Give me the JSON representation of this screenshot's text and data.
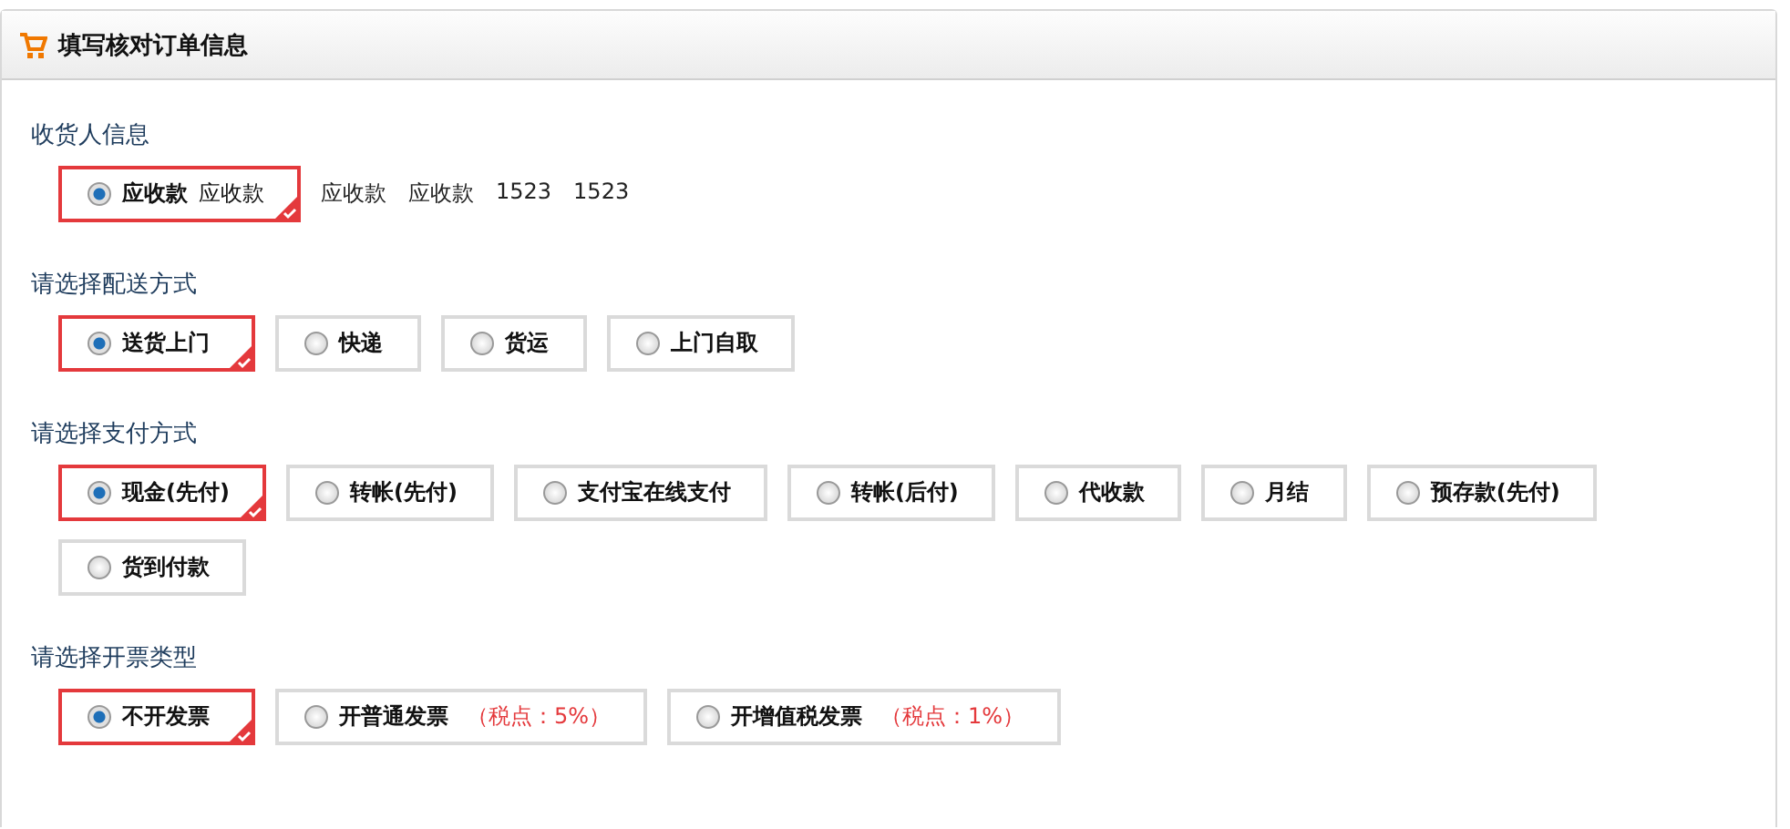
{
  "panel": {
    "title": "填写核对订单信息"
  },
  "sections": [
    {
      "title": "收货人信息",
      "options": [
        {
          "label": "应收款",
          "sub": "应收款",
          "selected": true
        }
      ],
      "extras": [
        "应收款",
        "应收款",
        "1523",
        "1523"
      ]
    },
    {
      "title": "请选择配送方式",
      "options": [
        {
          "label": "送货上门",
          "selected": true
        },
        {
          "label": "快递",
          "selected": false
        },
        {
          "label": "货运",
          "selected": false
        },
        {
          "label": "上门自取",
          "selected": false
        }
      ]
    },
    {
      "title": "请选择支付方式",
      "options": [
        {
          "label": "现金(先付)",
          "selected": true
        },
        {
          "label": "转帐(先付)",
          "selected": false
        },
        {
          "label": "支付宝在线支付",
          "selected": false
        },
        {
          "label": "转帐(后付)",
          "selected": false
        },
        {
          "label": "代收款",
          "selected": false
        },
        {
          "label": "月结",
          "selected": false
        },
        {
          "label": "预存款(先付)",
          "selected": false
        },
        {
          "label": "货到付款",
          "selected": false
        }
      ]
    },
    {
      "title": "请选择开票类型",
      "options": [
        {
          "label": "不开发票",
          "selected": true
        },
        {
          "label": "开普通发票",
          "note": "（税点：5%）",
          "selected": false
        },
        {
          "label": "开增值税发票",
          "note": "（税点：1%）",
          "selected": false
        }
      ]
    }
  ]
}
